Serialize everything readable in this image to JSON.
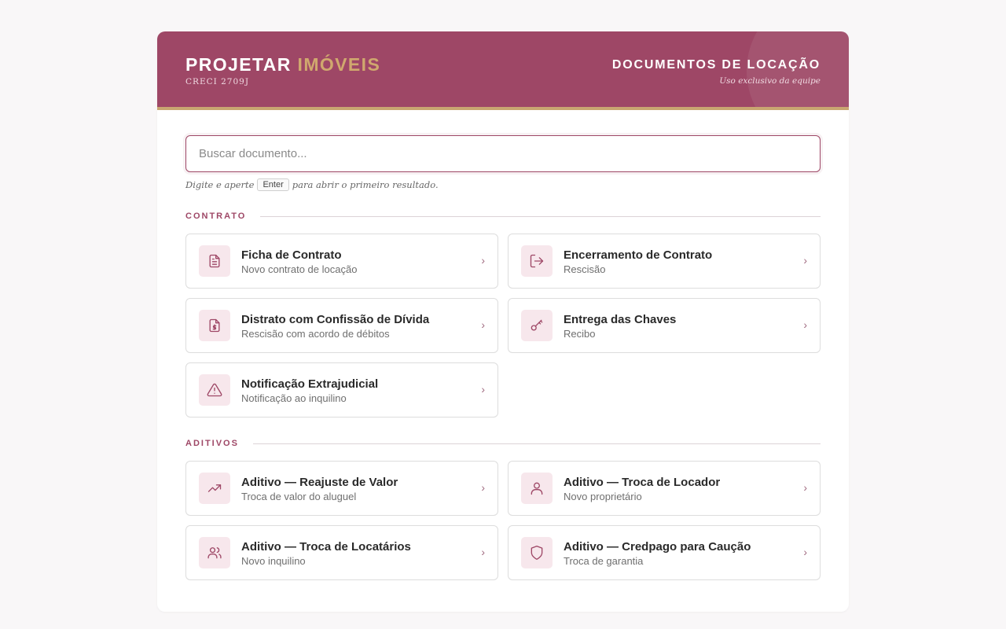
{
  "header": {
    "brand_primary": "PROJETAR",
    "brand_accent": "IMÓVEIS",
    "creci": "CRECI 2709J",
    "title": "DOCUMENTOS DE LOCAÇÃO",
    "subtitle": "Uso exclusivo da equipe"
  },
  "search": {
    "placeholder": "Buscar documento...",
    "hint_before": "Digite e aperte",
    "hint_key": "Enter",
    "hint_after": "para abrir o primeiro resultado."
  },
  "colors": {
    "accent": "#9e4766",
    "gold": "#c9a671",
    "icon_bg": "#f7e7ec"
  },
  "sections": [
    {
      "label": "CONTRATO",
      "items": [
        {
          "title": "Ficha de Contrato",
          "subtitle": "Novo contrato de locação",
          "icon": "document-icon"
        },
        {
          "title": "Encerramento de Contrato",
          "subtitle": "Rescisão",
          "icon": "log-out-icon"
        },
        {
          "title": "Distrato com Confissão de Dívida",
          "subtitle": "Rescisão com acordo de débitos",
          "icon": "file-dollar-icon"
        },
        {
          "title": "Entrega das Chaves",
          "subtitle": "Recibo",
          "icon": "key-icon"
        },
        {
          "title": "Notificação Extrajudicial",
          "subtitle": "Notificação ao inquilino",
          "icon": "warning-icon"
        }
      ]
    },
    {
      "label": "ADITIVOS",
      "items": [
        {
          "title": "Aditivo — Reajuste de Valor",
          "subtitle": "Troca de valor do aluguel",
          "icon": "trending-up-icon"
        },
        {
          "title": "Aditivo — Troca de Locador",
          "subtitle": "Novo proprietário",
          "icon": "user-icon"
        },
        {
          "title": "Aditivo — Troca de Locatários",
          "subtitle": "Novo inquilino",
          "icon": "users-icon"
        },
        {
          "title": "Aditivo — Credpago para Caução",
          "subtitle": "Troca de garantia",
          "icon": "shield-icon"
        }
      ]
    }
  ]
}
